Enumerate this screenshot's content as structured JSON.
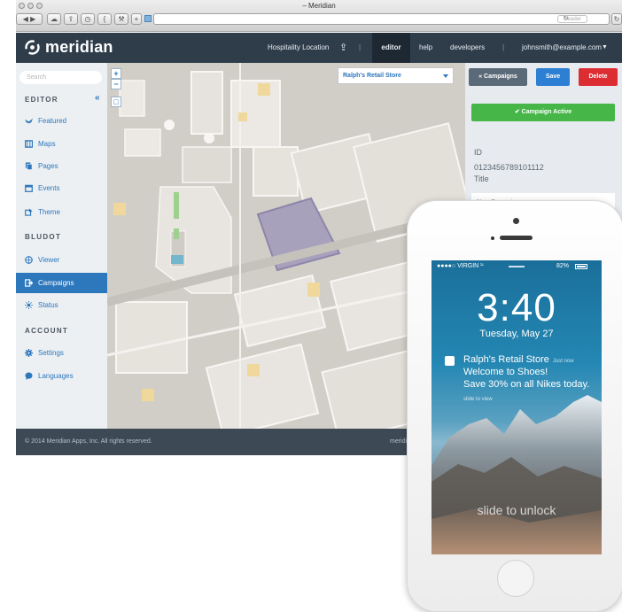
{
  "browser": {
    "window_title": "– Meridian",
    "reader_label": "Reader"
  },
  "header": {
    "logo_text": "meridian",
    "location": "Hospitality Location",
    "nav": {
      "editor": "editor",
      "help": "help",
      "developers": "developers",
      "separator": "|",
      "user": "johnsmith@example.com"
    }
  },
  "sidebar": {
    "search_placeholder": "Search",
    "collapse_symbol": "«",
    "sections": {
      "editor": "EDITOR",
      "bludot": "BLUDOT",
      "account": "ACCOUNT"
    },
    "items": {
      "featured": "Featured",
      "maps": "Maps",
      "pages": "Pages",
      "events": "Events",
      "theme": "Theme",
      "viewer": "Viewer",
      "campaigns": "Campaigns",
      "status": "Status",
      "settings": "Settings",
      "languages": "Languages"
    },
    "active_item": "Campaigns"
  },
  "map": {
    "zoom_in": "+",
    "zoom_out": "−",
    "selected_store": "Ralph's Retail Store"
  },
  "panel": {
    "campaigns_button": "« Campaigns",
    "save_button": "Save",
    "delete_button": "Delete",
    "active_button": "✔  Campaign Active",
    "id_label": "ID",
    "id_value": "0123456789101112",
    "title_label": "Title",
    "title_value": "New Campaign"
  },
  "footer": {
    "copyright": "© 2014 Meridian Apps, Inc. All rights reserved.",
    "brand_fragment": "meridian"
  },
  "phone": {
    "carrier": "●●●●○ VIRGIN",
    "battery": "82%",
    "time": "3:40",
    "date": "Tuesday, May 27",
    "notification": {
      "title": "Ralph's Retail Store",
      "time": "Just now",
      "line1": "Welcome to Shoes!",
      "line2": "Save 30% on all Nikes today.",
      "slide_hint": "slide to view"
    },
    "unlock_text": "slide to unlock"
  },
  "colors": {
    "header_bg": "#2f3d4b",
    "accent_blue": "#2d77bd",
    "save_blue": "#2d7fd3",
    "delete_red": "#dc2d33",
    "active_green": "#47b649",
    "campaigns_btn": "#5a6a79",
    "store_highlight": "#a7a1bc"
  }
}
